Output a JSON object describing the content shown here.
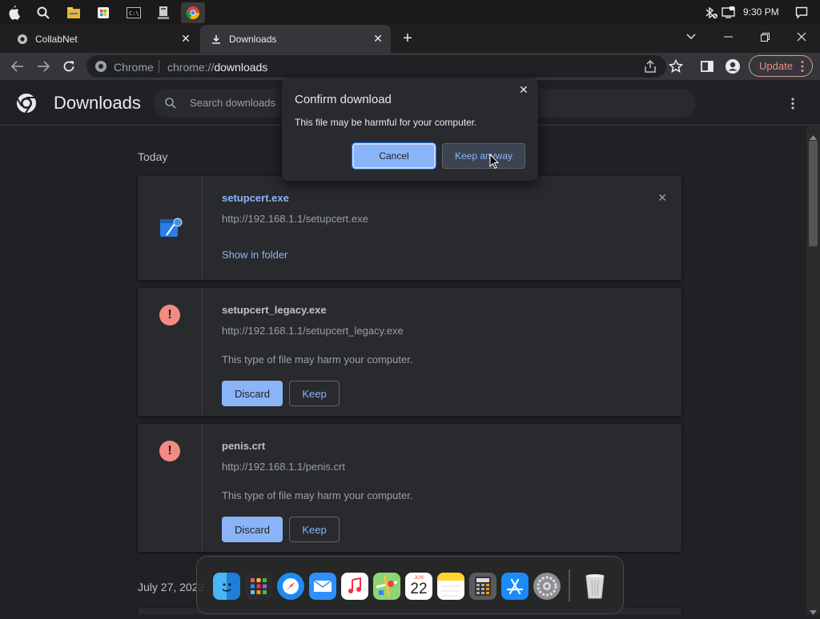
{
  "taskbar": {
    "icons": [
      "apple-icon",
      "search-icon",
      "file-explorer-icon",
      "store-icon",
      "terminal-icon",
      "network-drive-icon",
      "chrome-icon"
    ],
    "clock": "9:30 PM"
  },
  "tabs": [
    {
      "label": "CollabNet",
      "active": false
    },
    {
      "label": "Downloads",
      "active": true
    }
  ],
  "omnibox": {
    "site": "Chrome",
    "url_prefix": "chrome://",
    "url_path": "downloads"
  },
  "toolbar": {
    "update_label": "Update"
  },
  "page": {
    "title": "Downloads",
    "search_placeholder": "Search downloads"
  },
  "sections": {
    "today": "Today",
    "older": "July 27, 2022"
  },
  "downloads": [
    {
      "name": "setupcert.exe",
      "url": "http://192.168.1.1/setupcert.exe",
      "action": "Show in folder"
    },
    {
      "name": "setupcert_legacy.exe",
      "url": "http://192.168.1.1/setupcert_legacy.exe",
      "warning": "This type of file may harm your computer.",
      "discard_label": "Discard",
      "keep_label": "Keep"
    },
    {
      "name": "penis.crt",
      "url": "http://192.168.1.1/penis.crt",
      "warning": "This type of file may harm your computer.",
      "discard_label": "Discard",
      "keep_label": "Keep"
    }
  ],
  "dialog": {
    "title": "Confirm download",
    "message": "This file may be harmful for your computer.",
    "cancel_label": "Cancel",
    "keep_label": "Keep anyway"
  },
  "dock": {
    "calendar_month": "JUN",
    "calendar_day": "22"
  },
  "colors": {
    "accent": "#8ab4f8",
    "warning": "#f28b82",
    "background": "#202124",
    "card": "#292a2d"
  }
}
